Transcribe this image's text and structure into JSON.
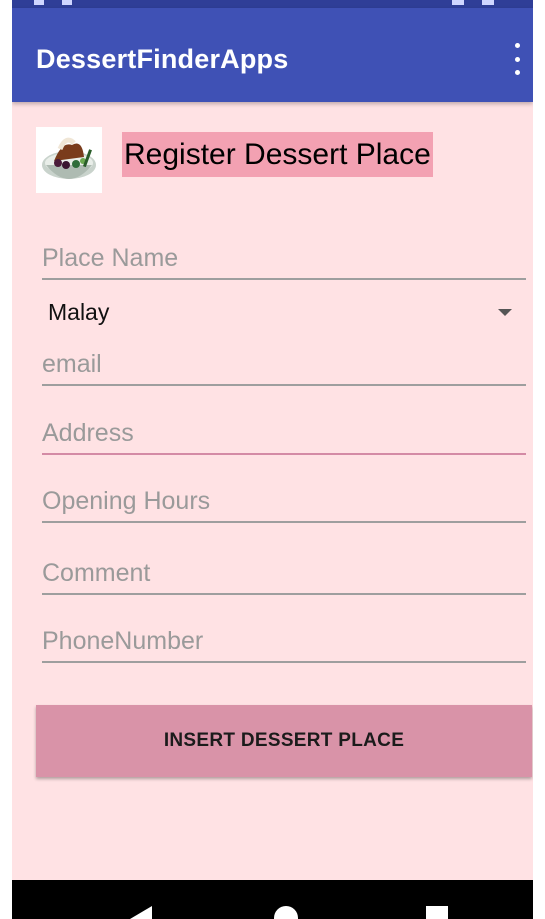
{
  "app": {
    "title": "DessertFinderApps",
    "overflow_icon": "more-vert-icon",
    "theme_colors": {
      "app_bar": "#3f51b5",
      "background": "#ffe2e4",
      "button": "#d993a8",
      "header_label_bg": "#f3a1b2"
    }
  },
  "header": {
    "logo_icon": "dessert-bowl-image",
    "title": "Register Dessert Place"
  },
  "form": {
    "place_name": {
      "placeholder": "Place Name",
      "value": ""
    },
    "category": {
      "selected": "Malay"
    },
    "email": {
      "placeholder": "email",
      "value": ""
    },
    "address": {
      "placeholder": "Address",
      "value": ""
    },
    "opening_hours": {
      "placeholder": "Opening Hours",
      "value": ""
    },
    "comment": {
      "placeholder": "Comment",
      "value": ""
    },
    "phone": {
      "placeholder": "PhoneNumber",
      "value": ""
    }
  },
  "actions": {
    "insert_label": "INSERT DESSERT PLACE"
  },
  "navbar": {
    "icons": [
      "back-icon",
      "home-icon",
      "recents-icon"
    ]
  }
}
